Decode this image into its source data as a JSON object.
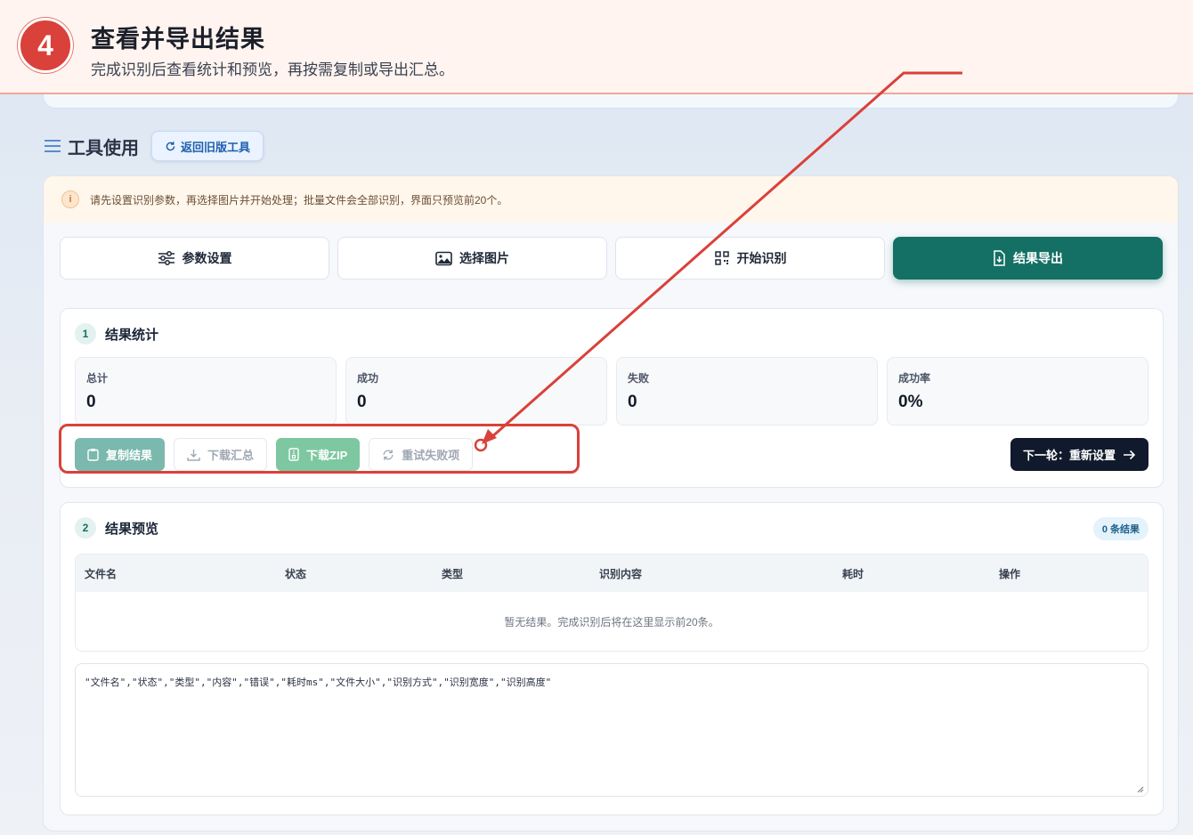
{
  "banner": {
    "step_number": "4",
    "title": "查看并导出结果",
    "subtitle": "完成识别后查看统计和预览，再按需复制或导出汇总。"
  },
  "tool_section": {
    "title": "工具使用",
    "back_button": "返回旧版工具"
  },
  "notice": {
    "icon": "i",
    "text": "请先设置识别参数，再选择图片并开始处理；批量文件会全部识别，界面只预览前20个。"
  },
  "tabs": [
    {
      "label": "参数设置",
      "icon": "sliders-icon"
    },
    {
      "label": "选择图片",
      "icon": "image-icon"
    },
    {
      "label": "开始识别",
      "icon": "qr-scan-icon"
    },
    {
      "label": "结果导出",
      "icon": "file-download-icon",
      "active": true
    }
  ],
  "stats_panel": {
    "number": "1",
    "title": "结果统计",
    "stats": [
      {
        "label": "总计",
        "value": "0"
      },
      {
        "label": "成功",
        "value": "0"
      },
      {
        "label": "失败",
        "value": "0"
      },
      {
        "label": "成功率",
        "value": "0%"
      }
    ],
    "actions": {
      "copy": "复制结果",
      "download_summary": "下载汇总",
      "download_zip": "下载ZIP",
      "retry_failed": "重试失败项"
    },
    "next_button": "下一轮：重新设置"
  },
  "preview_panel": {
    "number": "2",
    "title": "结果预览",
    "count_badge": "0 条结果",
    "columns": [
      "文件名",
      "状态",
      "类型",
      "识别内容",
      "耗时",
      "操作"
    ],
    "empty_text": "暂无结果。完成识别后将在这里显示前20条。",
    "csv_text": "\"文件名\",\"状态\",\"类型\",\"内容\",\"错误\",\"耗时ms\",\"文件大小\",\"识别方式\",\"识别宽度\",\"识别高度\""
  },
  "colors": {
    "accent": "#147065",
    "annotation": "#d9413a",
    "dark_button": "#111a2c"
  }
}
